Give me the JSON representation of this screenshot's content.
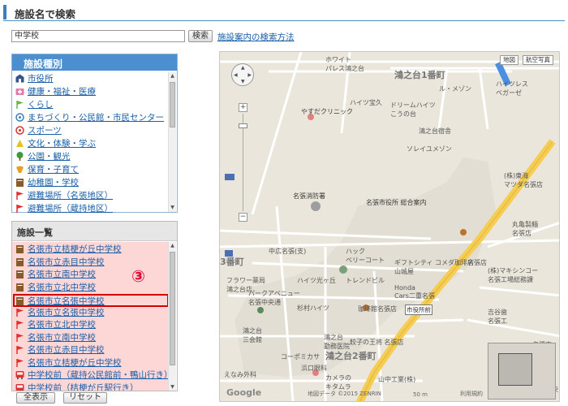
{
  "header": {
    "title": "施設名で検索"
  },
  "search": {
    "value": "中学校",
    "button_label": "検索",
    "help_link": "施設案内の検索方法"
  },
  "facility_types": {
    "title": "施設種別",
    "items": [
      {
        "label": "市役所",
        "icon": "city-hall-icon",
        "color": "#34568b"
      },
      {
        "label": "健康・福祉・医療",
        "icon": "medical-icon",
        "color": "#e07aa8"
      },
      {
        "label": "くらし",
        "icon": "flag-icon",
        "color": "#6bb548"
      },
      {
        "label": "まちづくり・公民館・市民センター",
        "icon": "community-icon",
        "color": "#3d7fb8"
      },
      {
        "label": "スポーツ",
        "icon": "sports-icon",
        "color": "#d83030"
      },
      {
        "label": "文化・体験・学ぶ",
        "icon": "culture-icon",
        "color": "#e8c020"
      },
      {
        "label": "公園・観光",
        "icon": "tree-icon",
        "color": "#3d9a3d"
      },
      {
        "label": "保育・子育て",
        "icon": "childcare-icon",
        "color": "#e8a020"
      },
      {
        "label": "幼稚園・学校",
        "icon": "school-icon",
        "color": "#8b5a2b"
      },
      {
        "label": "避難場所（名張地区）",
        "icon": "evacuation-flag-icon",
        "color": "#e03030"
      },
      {
        "label": "避難場所（蔵持地区）",
        "icon": "evacuation-flag-icon",
        "color": "#e03030"
      }
    ]
  },
  "facility_list": {
    "title": "施設一覧",
    "items": [
      {
        "label": "名張市立桔梗が丘中学校",
        "icon": "school-icon",
        "color": "#8b5a2b"
      },
      {
        "label": "名張市立赤目中学校",
        "icon": "school-icon",
        "color": "#8b5a2b"
      },
      {
        "label": "名張市立南中学校",
        "icon": "school-icon",
        "color": "#8b5a2b"
      },
      {
        "label": "名張市立北中学校",
        "icon": "school-icon",
        "color": "#8b5a2b"
      },
      {
        "label": "名張市立名張中学校",
        "icon": "school-icon",
        "color": "#8b5a2b"
      },
      {
        "label": "名張市立名張中学校",
        "icon": "evacuation-flag-icon",
        "color": "#e03030"
      },
      {
        "label": "名張市立北中学校",
        "icon": "evacuation-flag-icon",
        "color": "#e03030"
      },
      {
        "label": "名張市立南中学校",
        "icon": "evacuation-flag-icon",
        "color": "#e03030"
      },
      {
        "label": "名張市立赤目中学校",
        "icon": "evacuation-flag-icon",
        "color": "#e03030"
      },
      {
        "label": "名張市立桔梗が丘中学校",
        "icon": "evacuation-flag-icon",
        "color": "#e03030"
      },
      {
        "label": "中学校前（蔵持公民館前・鴨山行き）",
        "icon": "bus-icon",
        "color": "#e03030"
      },
      {
        "label": "中学校前（桔梗が丘駅行き）",
        "icon": "bus-icon",
        "color": "#e03030"
      }
    ],
    "selected_index": 4,
    "annotation": "③"
  },
  "buttons": {
    "show_all": "全表示",
    "reset": "リセット"
  },
  "map": {
    "map_type_map": "地図",
    "map_type_satellite": "航空写真",
    "labels": [
      {
        "text": "鴻之台1番町",
        "cls": "area"
      },
      {
        "text": "鴻之台2番町",
        "cls": "area"
      },
      {
        "text": "3番町",
        "cls": "area"
      },
      {
        "text": "ホワイト\nパレス鴻之台",
        "cls": ""
      },
      {
        "text": "ハイツ宝久",
        "cls": ""
      },
      {
        "text": "ル・メゾン",
        "cls": ""
      },
      {
        "text": "ハイツレス\nベガーゼ",
        "cls": ""
      },
      {
        "text": "ドリームハイツ\nこうの台",
        "cls": ""
      },
      {
        "text": "鴻之台宿舎",
        "cls": ""
      },
      {
        "text": "ソレイユメゾン",
        "cls": ""
      },
      {
        "text": "やすだクリニック",
        "cls": "dark"
      },
      {
        "text": "名張消防署",
        "cls": "dark"
      },
      {
        "text": "名張市役所 総合案内",
        "cls": "dark"
      },
      {
        "text": "(株)東海\nマツダ名張店",
        "cls": ""
      },
      {
        "text": "丸亀製麺\n名張店",
        "cls": ""
      },
      {
        "text": "中広名張(支)",
        "cls": ""
      },
      {
        "text": "ハック\nベリーコート",
        "cls": ""
      },
      {
        "text": "ギフトシティ\n山城屋",
        "cls": ""
      },
      {
        "text": "コメダ珈琲店",
        "cls": ""
      },
      {
        "text": "名張店",
        "cls": ""
      },
      {
        "text": "フラワー薬局\n鴻之台店",
        "cls": ""
      },
      {
        "text": "ハイツ光ヶ丘",
        "cls": ""
      },
      {
        "text": "トレンドビル",
        "cls": ""
      },
      {
        "text": "Honda\nCars二重名張",
        "cls": ""
      },
      {
        "text": "(株)マキシンコー\n名張工場総務課",
        "cls": ""
      },
      {
        "text": "パークアベニュー\n名張中央通",
        "cls": ""
      },
      {
        "text": "杉村ハイツ",
        "cls": ""
      },
      {
        "text": "珈琲館名張店",
        "cls": ""
      },
      {
        "text": "市役所前",
        "cls": "station"
      },
      {
        "text": "吉谷歯\n名張工",
        "cls": ""
      },
      {
        "text": "鴻之台\n三会館",
        "cls": ""
      },
      {
        "text": "餃子の王将 名張店",
        "cls": ""
      },
      {
        "text": "鴻之台\n勤務医院",
        "cls": ""
      },
      {
        "text": "コーポミカサ",
        "cls": ""
      },
      {
        "text": "浜口眼科",
        "cls": ""
      },
      {
        "text": "カメラの\nキタムラ",
        "cls": ""
      },
      {
        "text": "山中工業(株)",
        "cls": ""
      },
      {
        "text": "えなみ外科",
        "cls": ""
      },
      {
        "text": "名張中",
        "cls": ""
      },
      {
        "text": "名張中央",
        "cls": ""
      }
    ],
    "google": "Google",
    "copyright": "地図データ ©2015 ZENRIN",
    "scale": "50 m",
    "terms": "利用規約"
  }
}
